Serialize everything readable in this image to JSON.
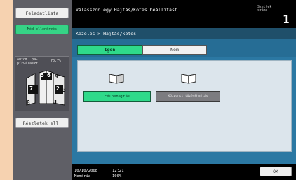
{
  "sidebar": {
    "task_list_label": "Feladatlista",
    "mode_check_label": "Mód ellenőrzés",
    "mode_label": "Autom. pa-pírválaszt.",
    "zoom": "70.7%",
    "page_numbers": [
      "5",
      "6",
      "4",
      "7",
      "2",
      "3",
      "8",
      "1"
    ],
    "details_label": "Részletek ell."
  },
  "header": {
    "message": "Válasszon egy Hajtás/Kötés beállítást.",
    "copies_label": "Szettek száma",
    "copies_value": "1"
  },
  "breadcrumb": "Kezelés > Hajtás/kötés",
  "tabs": {
    "yes": "Igen",
    "no": "Nem"
  },
  "options": {
    "half_fold": "Félbehajtás",
    "center_staple": "Központi tűzés&hajtás"
  },
  "status": {
    "date": "10/10/2008",
    "time": "12:21",
    "memory_label": "Memória",
    "memory_value": "100%"
  },
  "ok_label": "OK"
}
